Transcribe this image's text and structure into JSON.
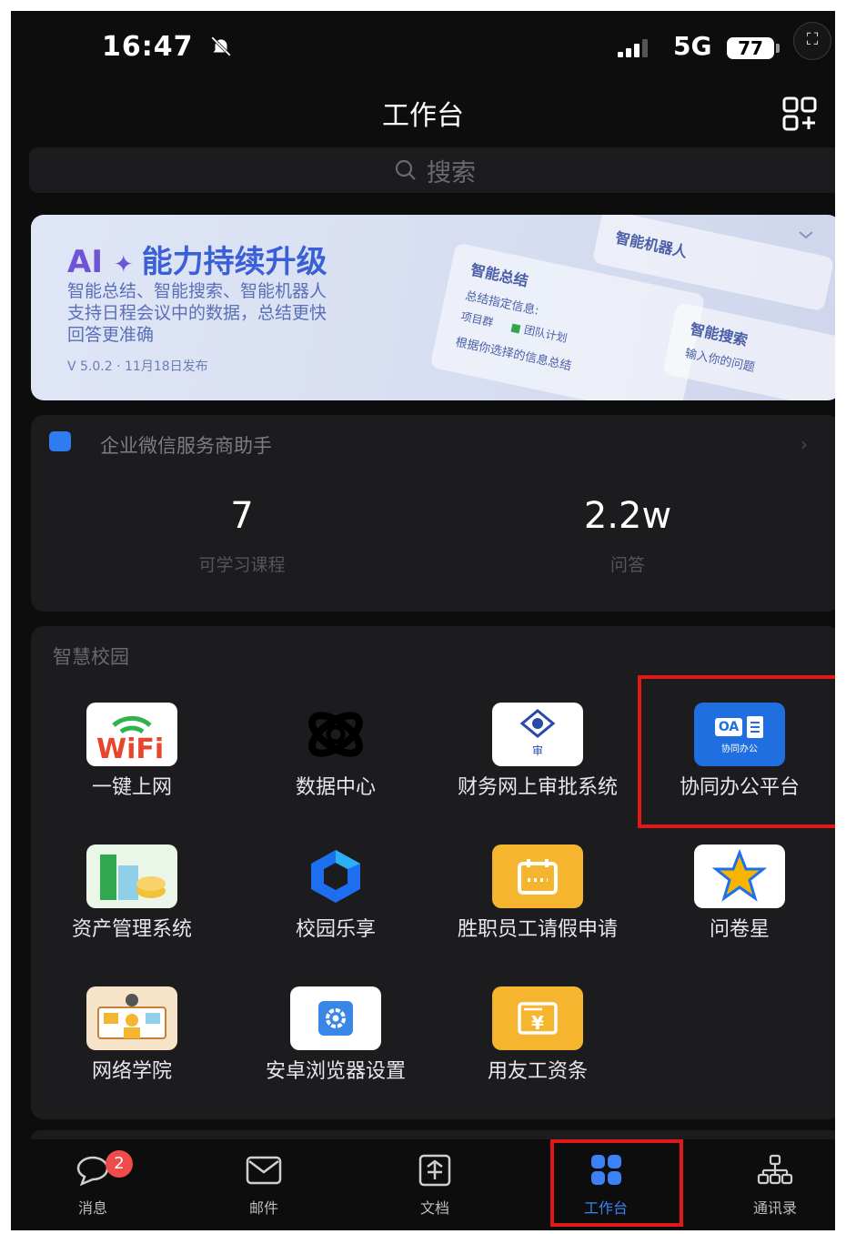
{
  "status_bar": {
    "time": "16:47",
    "network": "5G",
    "battery": "77"
  },
  "header": {
    "title": "工作台"
  },
  "search": {
    "placeholder": "搜索"
  },
  "banner": {
    "ai": "AI",
    "title": "能力持续升级",
    "line1": "智能总结、智能搜索、智能机器人",
    "line2": "支持日程会议中的数据，总结更快",
    "line3": "回答更准确",
    "version": "V 5.0.2 · 11月18日发布",
    "card1": "智能机器人",
    "card2": "智能总结",
    "card2_sub": "总结指定信息:",
    "card2_tag1": "项目群",
    "card2_tag2": "团队计划",
    "card2_foot": "根据你选择的信息总结",
    "card3": "智能搜索",
    "card3_sub": "输入你的问题"
  },
  "assistant": {
    "title": "企业微信服务商助手",
    "stats": [
      {
        "value": "7",
        "label": "可学习课程"
      },
      {
        "value": "2.2w",
        "label": "问答"
      }
    ]
  },
  "campus": {
    "title": "智慧校园",
    "apps": [
      {
        "label": "一键上网",
        "icon": "wifi-icon"
      },
      {
        "label": "数据中心",
        "icon": "data-center-icon"
      },
      {
        "label": "财务网上审批系统",
        "icon": "finance-approval-icon"
      },
      {
        "label": "协同办公平台",
        "icon": "oa-icon"
      },
      {
        "label": "资产管理系统",
        "icon": "asset-management-icon"
      },
      {
        "label": "校园乐享",
        "icon": "campus-share-icon"
      },
      {
        "label": "胜职员工请假申请",
        "icon": "leave-request-icon"
      },
      {
        "label": "问卷星",
        "icon": "star-icon"
      },
      {
        "label": "网络学院",
        "icon": "online-academy-icon"
      },
      {
        "label": "安卓浏览器设置",
        "icon": "android-browser-settings-icon"
      },
      {
        "label": "用友工资条",
        "icon": "payslip-icon"
      }
    ],
    "oa_tag": "协同办公",
    "finance_text": "审"
  },
  "tabbar": {
    "messages_badge": "2",
    "tabs": [
      {
        "label": "消息"
      },
      {
        "label": "邮件"
      },
      {
        "label": "文档"
      },
      {
        "label": "工作台"
      },
      {
        "label": "通讯录"
      }
    ]
  },
  "colors": {
    "accent": "#3c82f6",
    "highlight": "#e01818",
    "background": "#0d0d0e",
    "card": "#1c1c1e"
  }
}
